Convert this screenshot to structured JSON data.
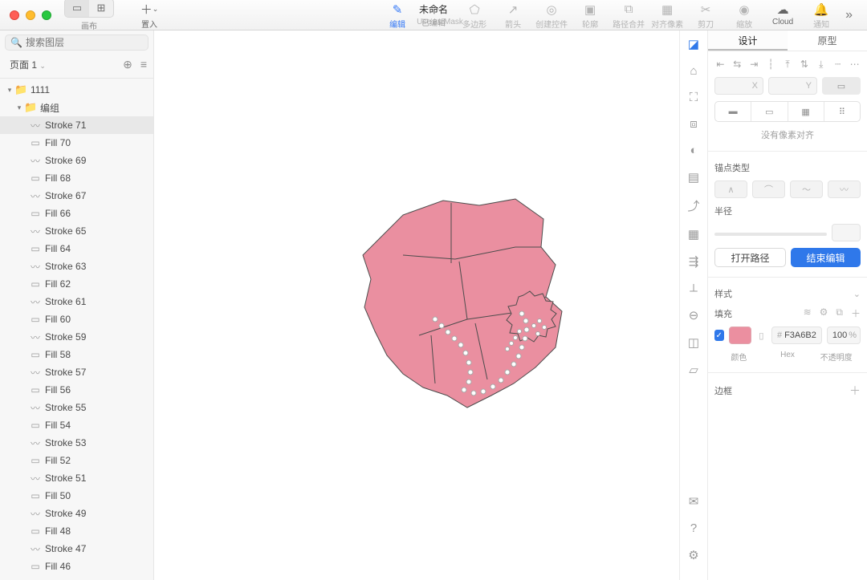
{
  "doc": {
    "title": "未命名",
    "subtitle": "已编辑"
  },
  "toolbar_left_label": "画布",
  "toolbar": [
    {
      "key": "insert",
      "icon": "＋",
      "label": "置入",
      "enabled": true,
      "accent": false,
      "caret": true
    },
    {
      "key": "edit",
      "icon": "✎",
      "label": "编辑",
      "enabled": true,
      "accent": true
    },
    {
      "key": "mask",
      "icon": "◔",
      "label": "Use as Mask",
      "enabled": false
    },
    {
      "key": "polygon",
      "icon": "⬠",
      "label": "多边形",
      "enabled": false
    },
    {
      "key": "arrow",
      "icon": "↗",
      "label": "箭头",
      "enabled": false
    },
    {
      "key": "widget",
      "icon": "◎",
      "label": "创建控件",
      "enabled": false
    },
    {
      "key": "outline",
      "icon": "▣",
      "label": "轮廓",
      "enabled": false
    },
    {
      "key": "pathop",
      "icon": "⧉",
      "label": "路径合并",
      "enabled": false
    },
    {
      "key": "pixel",
      "icon": "▦",
      "label": "对齐像素",
      "enabled": false
    },
    {
      "key": "scissor",
      "icon": "✂",
      "label": "剪刀",
      "enabled": false
    },
    {
      "key": "zoom",
      "icon": "◉",
      "label": "缩放",
      "enabled": false
    },
    {
      "key": "cloud",
      "icon": "☁",
      "label": "Cloud",
      "enabled": true
    },
    {
      "key": "notify",
      "icon": "🔔",
      "label": "通知",
      "enabled": false
    }
  ],
  "search_placeholder": "搜索图层",
  "page_label": "页面 1",
  "tree": {
    "root": {
      "name": "1111"
    },
    "group": {
      "name": "编组"
    },
    "layers": [
      "Stroke 71",
      "Fill 70",
      "Stroke 69",
      "Fill 68",
      "Stroke 67",
      "Fill 66",
      "Stroke 65",
      "Fill 64",
      "Stroke 63",
      "Fill 62",
      "Stroke 61",
      "Fill 60",
      "Stroke 59",
      "Fill 58",
      "Stroke 57",
      "Fill 56",
      "Stroke 55",
      "Fill 54",
      "Stroke 53",
      "Fill 52",
      "Stroke 51",
      "Fill 50",
      "Stroke 49",
      "Fill 48",
      "Stroke 47",
      "Fill 46"
    ],
    "selected_index": 0
  },
  "inspector": {
    "tabs": {
      "design": "设计",
      "prototype": "原型"
    },
    "coord_x_suffix": "X",
    "coord_y_suffix": "Y",
    "align_empty": "没有像素对齐",
    "anchor_label": "锚点类型",
    "radius_label": "半径",
    "open_path": "打开路径",
    "finish_edit": "结束编辑",
    "style_label": "样式",
    "fill_label": "填充",
    "fill_hex": "F3A6B2",
    "fill_opacity": "100",
    "color_lbl": "颜色",
    "hex_lbl": "Hex",
    "opacity_lbl": "不透明度",
    "border_label": "边框"
  }
}
